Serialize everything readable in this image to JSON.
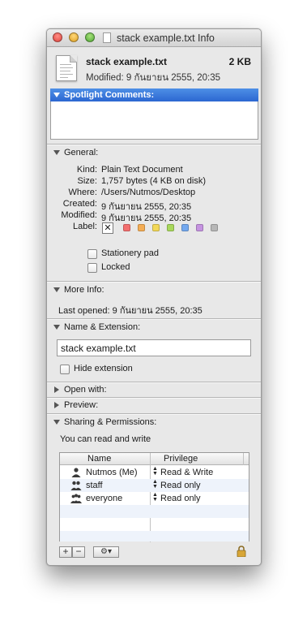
{
  "window": {
    "title": "stack example.txt Info"
  },
  "header": {
    "file_name": "stack example.txt",
    "file_size": "2 KB",
    "modified": "Modified: 9 กันยายน 2555, 20:35"
  },
  "spotlight": {
    "title": "Spotlight Comments:",
    "value": ""
  },
  "general": {
    "title": "General:",
    "rows": [
      {
        "key": "Kind:",
        "value": "Plain Text Document"
      },
      {
        "key": "Size:",
        "value": "1,757 bytes (4 KB on disk)"
      },
      {
        "key": "Where:",
        "value": "/Users/Nutmos/Desktop"
      },
      {
        "key": "Created:",
        "value": "9 กันยายน 2555, 20:35"
      },
      {
        "key": "Modified:",
        "value": "9 กันยายน 2555, 20:35"
      }
    ],
    "label_key": "Label:",
    "label_none": "✕",
    "label_colors": [
      "#f36f6f",
      "#f4ad55",
      "#f2d858",
      "#a8d85c",
      "#74a9ef",
      "#c593e0",
      "#b7b7b7"
    ],
    "stationery_label": "Stationery pad",
    "locked_label": "Locked"
  },
  "more_info": {
    "title": "More Info:",
    "last_opened": "Last opened: 9 กันยายน 2555, 20:35"
  },
  "name_extension": {
    "title": "Name & Extension:",
    "name_value": "stack example.txt",
    "hide_extension_label": "Hide extension"
  },
  "open_with": {
    "title": "Open with:"
  },
  "preview": {
    "title": "Preview:"
  },
  "sharing": {
    "title": "Sharing & Permissions:",
    "summary": "You can read and write",
    "columns": [
      "Name",
      "Privilege"
    ],
    "rows": [
      {
        "name": "Nutmos (Me)",
        "privilege": "Read & Write",
        "icon": "single-user-icon"
      },
      {
        "name": "staff",
        "privilege": "Read only",
        "icon": "group-icon"
      },
      {
        "name": "everyone",
        "privilege": "Read only",
        "icon": "everyone-icon"
      }
    ],
    "add_label": "+",
    "remove_label": "−",
    "action_label": "⚙▾"
  }
}
